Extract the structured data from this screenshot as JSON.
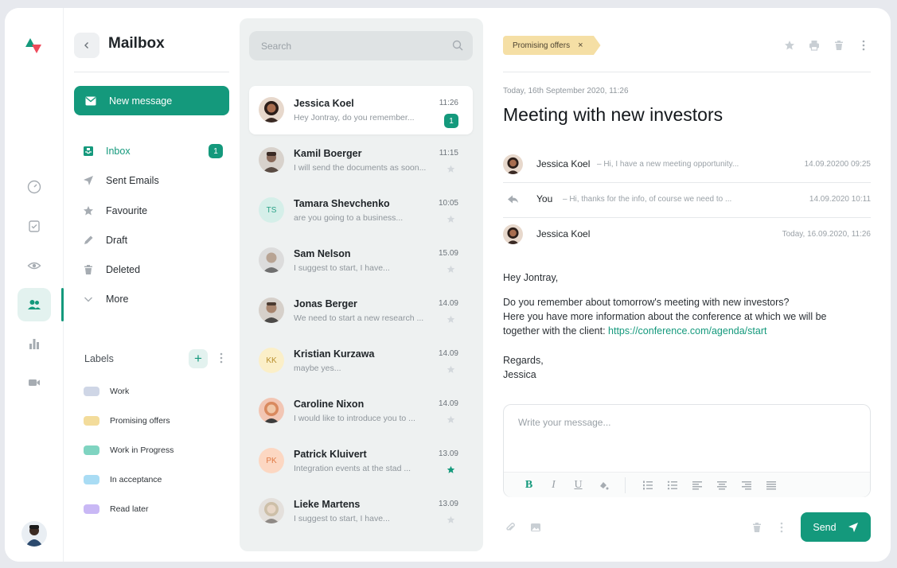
{
  "rail": {
    "logo": "logo-mark",
    "items": [
      {
        "name": "dashboard-icon"
      },
      {
        "name": "tasks-icon"
      },
      {
        "name": "eye-icon"
      },
      {
        "name": "contacts-icon",
        "active": true
      },
      {
        "name": "analytics-icon"
      },
      {
        "name": "video-icon"
      }
    ]
  },
  "mailbox": {
    "title": "Mailbox",
    "new_message": "New message",
    "folders": [
      {
        "label": "Inbox",
        "badge": "1",
        "icon": "inbox-icon",
        "active": true
      },
      {
        "label": "Sent Emails",
        "icon": "send-icon"
      },
      {
        "label": "Favourite",
        "icon": "star-icon"
      },
      {
        "label": "Draft",
        "icon": "pencil-icon"
      },
      {
        "label": "Deleted",
        "icon": "trash-icon"
      },
      {
        "label": "More",
        "icon": "chevron-down-icon"
      }
    ],
    "labels_title": "Labels",
    "labels_add": "+",
    "labels": [
      {
        "label": "Work",
        "color": "#cfd6e6"
      },
      {
        "label": "Promising offers",
        "color": "#f3dc9b"
      },
      {
        "label": "Work in Progress",
        "color": "#7fd4c1"
      },
      {
        "label": "In acceptance",
        "color": "#a9dcf4"
      },
      {
        "label": "Read later",
        "color": "#c9b8f5"
      }
    ]
  },
  "search": {
    "placeholder": "Search"
  },
  "messages": [
    {
      "name": "Jessica Koel",
      "preview": "Hey Jontray, do you remember...",
      "time": "11:26",
      "badge": "1",
      "selected": true,
      "avatar": "photo",
      "avatar_color": "#6b4a3a"
    },
    {
      "name": "Kamil Boerger",
      "preview": "I will send the documents as soon...",
      "time": "11:15",
      "avatar": "photo",
      "avatar_color": "#7a6a62"
    },
    {
      "name": "Tamara Shevchenko",
      "preview": "are you going to a business...",
      "time": "10:05",
      "avatar": "TS",
      "avatar_bg": "#d5efe9",
      "avatar_fg": "#2aa287"
    },
    {
      "name": "Sam Nelson",
      "preview": "I suggest to start, I have...",
      "time": "15.09",
      "avatar": "photo",
      "avatar_color": "#8c8c8c"
    },
    {
      "name": "Jonas Berger",
      "preview": "We need to start a new research ...",
      "time": "14.09",
      "avatar": "photo",
      "avatar_color": "#7b6f66"
    },
    {
      "name": "Kristian Kurzawa",
      "preview": "maybe yes...",
      "time": "14.09",
      "avatar": "KK",
      "avatar_bg": "#fbefc8",
      "avatar_fg": "#b88f2c"
    },
    {
      "name": "Caroline Nixon",
      "preview": "I would like to introduce you to ...",
      "time": "14.09",
      "avatar": "photo",
      "avatar_color": "#d9895e"
    },
    {
      "name": "Patrick Kluivert",
      "preview": "Integration events at the stad ...",
      "time": "13.09",
      "avatar": "PK",
      "avatar_bg": "#fcd7c2",
      "avatar_fg": "#e07a45",
      "starred": true
    },
    {
      "name": "Lieke Martens",
      "preview": "I suggest to start, I have...",
      "time": "13.09",
      "avatar": "photo",
      "avatar_color": "#b8b0a8"
    }
  ],
  "reader": {
    "tag": "Promising offers",
    "tag_close": "×",
    "date": "Today, 16th September 2020, 11:26",
    "subject": "Meeting with new investors",
    "thread": [
      {
        "from": "Jessica Koel",
        "snippet": "– Hi, I have a new meeting opportunity...",
        "when": "14.09.20200 09:25",
        "avatar": "photo"
      },
      {
        "from": "You",
        "snippet": "– Hi, thanks for the info, of course we need to ...",
        "when": "14.09.2020 10:11",
        "avatar": "reply-icon"
      },
      {
        "from": "Jessica Koel",
        "snippet": "",
        "when": "Today, 16.09.2020, 11:26",
        "avatar": "photo"
      }
    ],
    "body": {
      "greeting": "Hey Jontray,",
      "line1": "Do you remember about tomorrow's meeting with new investors?",
      "line2": "Here you have more information about the conference at which we will be",
      "line3": "together with the client: ",
      "link": "https://conference.com/agenda/start",
      "regards": "Regards,",
      "signature": "Jessica"
    },
    "composer": {
      "placeholder": "Write your message..."
    },
    "send": "Send"
  },
  "colors": {
    "accent": "#14997c",
    "accent_light": "#e3f2ef",
    "list_bg": "#eef1f1"
  }
}
